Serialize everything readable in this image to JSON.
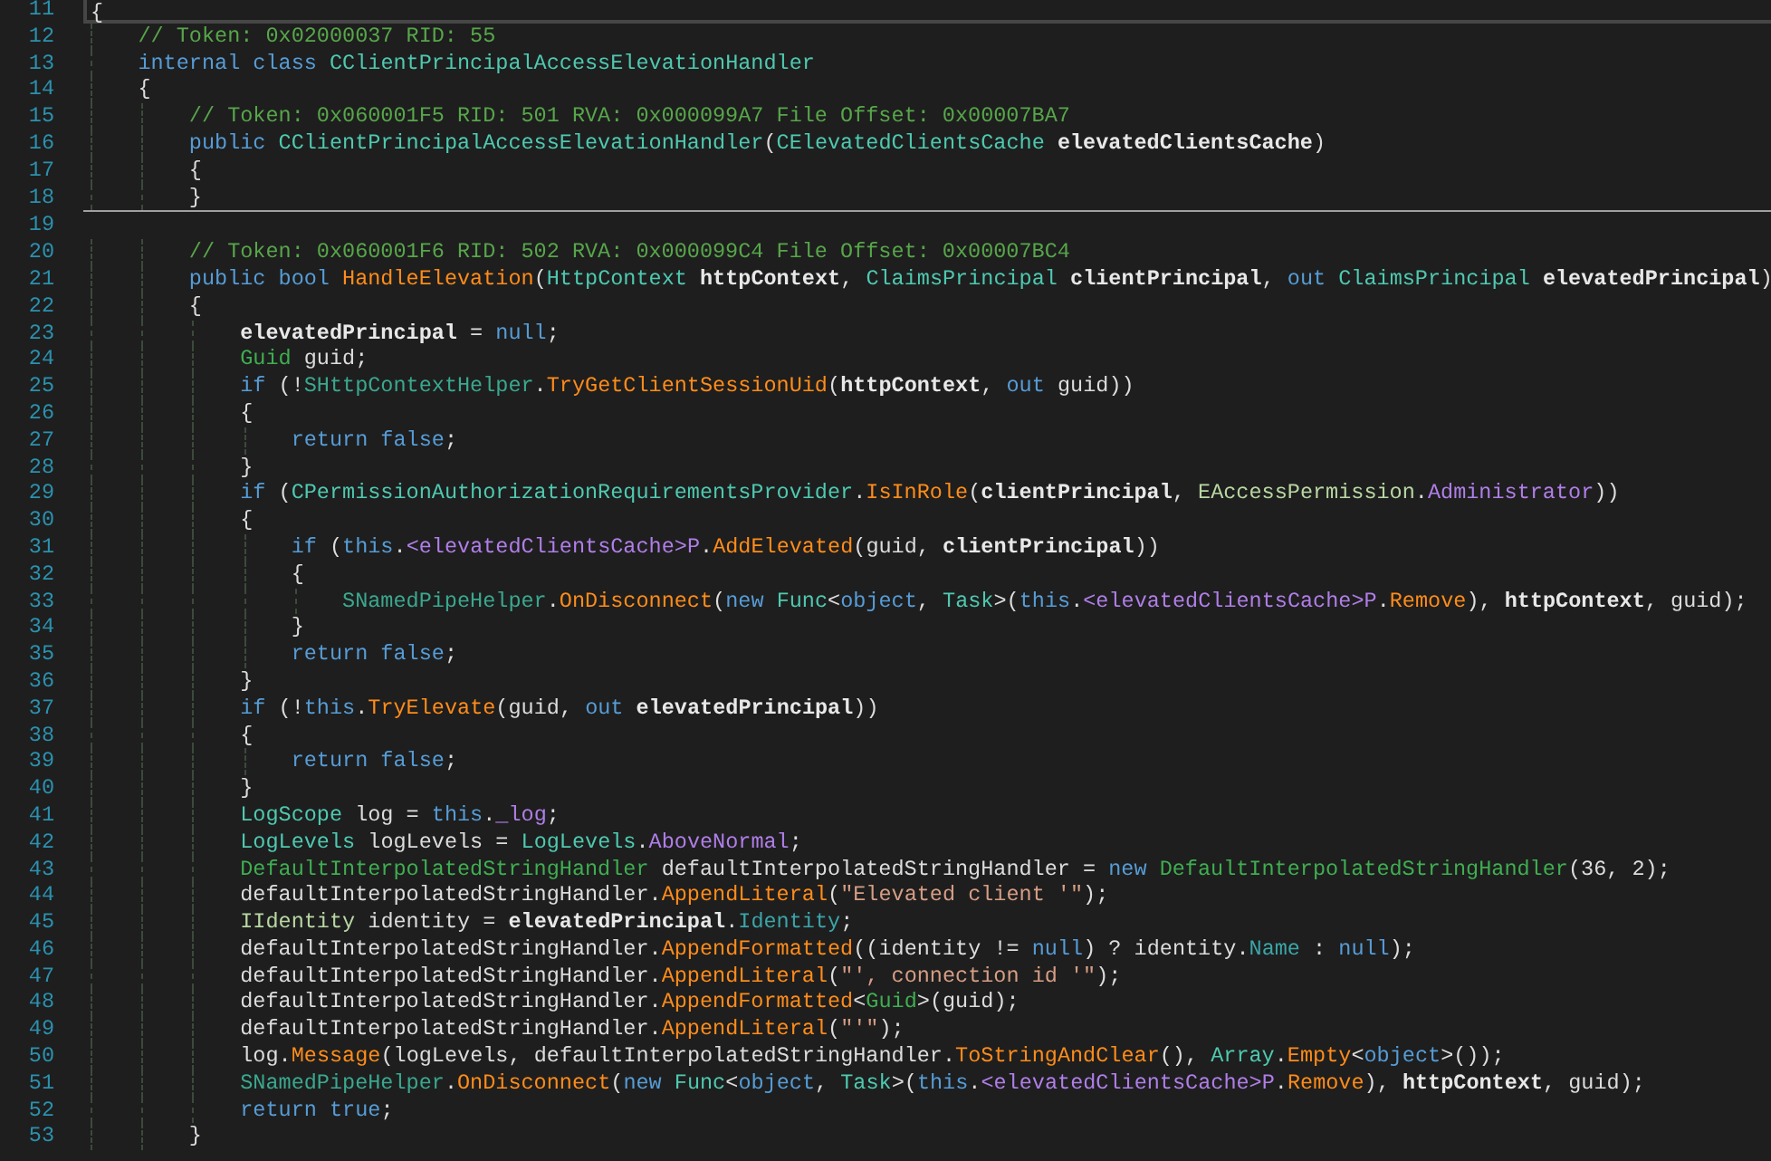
{
  "editor": {
    "blocks": [
      {
        "lines": [
          {
            "number": "11",
            "current": true,
            "tokens": [
              {
                "kind": "plain",
                "text": "{"
              }
            ]
          },
          {
            "number": "12",
            "current": false,
            "tokens": [
              {
                "kind": "comment",
                "text": "    // Token: 0x02000037 RID: 55"
              }
            ]
          },
          {
            "number": "13",
            "current": false,
            "tokens": [
              {
                "kind": "keyword",
                "text": "    internal class "
              },
              {
                "kind": "type",
                "text": "CClientPrincipalAccessElevationHandler"
              }
            ]
          },
          {
            "number": "14",
            "current": false,
            "tokens": [
              {
                "kind": "plain",
                "text": "    {"
              }
            ]
          },
          {
            "number": "15",
            "current": false,
            "tokens": [
              {
                "kind": "comment",
                "text": "        // Token: 0x060001F5 RID: 501 RVA: 0x000099A7 File Offset: 0x00007BA7"
              }
            ]
          },
          {
            "number": "16",
            "current": false,
            "tokens": [
              {
                "kind": "keyword",
                "text": "        public "
              },
              {
                "kind": "type",
                "text": "CClientPrincipalAccessElevationHandler"
              },
              {
                "kind": "plain",
                "text": "("
              },
              {
                "kind": "type",
                "text": "CElevatedClientsCache "
              },
              {
                "kind": "param",
                "text": "elevatedClientsCache"
              },
              {
                "kind": "plain",
                "text": ")"
              }
            ]
          },
          {
            "number": "17",
            "current": false,
            "tokens": [
              {
                "kind": "plain",
                "text": "        {"
              }
            ]
          },
          {
            "number": "18",
            "current": false,
            "tokens": [
              {
                "kind": "plain",
                "text": "        }"
              }
            ]
          }
        ]
      },
      {
        "lines": [
          {
            "number": "19",
            "current": false
          },
          {
            "number": "20",
            "current": false,
            "tokens": [
              {
                "kind": "comment",
                "text": "        // Token: 0x060001F6 RID: 502 RVA: 0x000099C4 File Offset: 0x00007BC4"
              }
            ]
          },
          {
            "number": "21",
            "current": false,
            "tokens": [
              {
                "kind": "keyword",
                "text": "        public bool "
              },
              {
                "kind": "method",
                "text": "HandleElevation"
              },
              {
                "kind": "plain",
                "text": "("
              },
              {
                "kind": "type",
                "text": "HttpContext "
              },
              {
                "kind": "param",
                "text": "httpContext"
              },
              {
                "kind": "plain",
                "text": ", "
              },
              {
                "kind": "type",
                "text": "ClaimsPrincipal "
              },
              {
                "kind": "param",
                "text": "clientPrincipal"
              },
              {
                "kind": "plain",
                "text": ", "
              },
              {
                "kind": "keyword",
                "text": "out "
              },
              {
                "kind": "type",
                "text": "ClaimsPrincipal "
              },
              {
                "kind": "param",
                "text": "elevatedPrincipal"
              },
              {
                "kind": "plain",
                "text": ")"
              }
            ]
          },
          {
            "number": "22",
            "current": false,
            "tokens": [
              {
                "kind": "plain",
                "text": "        {"
              }
            ]
          },
          {
            "number": "23",
            "current": false,
            "tokens": [
              {
                "kind": "param",
                "text": "            elevatedPrincipal"
              },
              {
                "kind": "plain",
                "text": " = "
              },
              {
                "kind": "keyword",
                "text": "null"
              },
              {
                "kind": "plain",
                "text": ";"
              }
            ]
          },
          {
            "number": "24",
            "current": false,
            "tokens": [
              {
                "kind": "struct",
                "text": "            Guid "
              },
              {
                "kind": "local",
                "text": "guid"
              },
              {
                "kind": "plain",
                "text": ";"
              }
            ]
          },
          {
            "number": "25",
            "current": false,
            "tokens": [
              {
                "kind": "keyword",
                "text": "            if"
              },
              {
                "kind": "plain",
                "text": " (!"
              },
              {
                "kind": "static",
                "text": "SHttpContextHelper"
              },
              {
                "kind": "plain",
                "text": "."
              },
              {
                "kind": "method",
                "text": "TryGetClientSessionUid"
              },
              {
                "kind": "plain",
                "text": "("
              },
              {
                "kind": "param",
                "text": "httpContext"
              },
              {
                "kind": "plain",
                "text": ", "
              },
              {
                "kind": "keyword",
                "text": "out "
              },
              {
                "kind": "local",
                "text": "guid"
              },
              {
                "kind": "plain",
                "text": "))"
              }
            ]
          },
          {
            "number": "26",
            "current": false,
            "tokens": [
              {
                "kind": "plain",
                "text": "            {"
              }
            ]
          },
          {
            "number": "27",
            "current": false,
            "tokens": [
              {
                "kind": "keyword",
                "text": "                return false"
              },
              {
                "kind": "plain",
                "text": ";"
              }
            ]
          },
          {
            "number": "28",
            "current": false,
            "tokens": [
              {
                "kind": "plain",
                "text": "            }"
              }
            ]
          },
          {
            "number": "29",
            "current": false,
            "tokens": [
              {
                "kind": "keyword",
                "text": "            if"
              },
              {
                "kind": "plain",
                "text": " ("
              },
              {
                "kind": "type",
                "text": "CPermissionAuthorizationRequirementsProvider"
              },
              {
                "kind": "plain",
                "text": "."
              },
              {
                "kind": "method",
                "text": "IsInRole"
              },
              {
                "kind": "plain",
                "text": "("
              },
              {
                "kind": "param",
                "text": "clientPrincipal"
              },
              {
                "kind": "plain",
                "text": ", "
              },
              {
                "kind": "enum",
                "text": "EAccessPermission"
              },
              {
                "kind": "plain",
                "text": "."
              },
              {
                "kind": "member",
                "text": "Administrator"
              },
              {
                "kind": "plain",
                "text": "))"
              }
            ]
          },
          {
            "number": "30",
            "current": false,
            "tokens": [
              {
                "kind": "plain",
                "text": "            {"
              }
            ]
          },
          {
            "number": "31",
            "current": false,
            "tokens": [
              {
                "kind": "keyword",
                "text": "                if"
              },
              {
                "kind": "plain",
                "text": " ("
              },
              {
                "kind": "keyword",
                "text": "this"
              },
              {
                "kind": "plain",
                "text": "."
              },
              {
                "kind": "member",
                "text": "<elevatedClientsCache>P"
              },
              {
                "kind": "plain",
                "text": "."
              },
              {
                "kind": "method",
                "text": "AddElevated"
              },
              {
                "kind": "plain",
                "text": "("
              },
              {
                "kind": "local",
                "text": "guid"
              },
              {
                "kind": "plain",
                "text": ", "
              },
              {
                "kind": "param",
                "text": "clientPrincipal"
              },
              {
                "kind": "plain",
                "text": "))"
              }
            ]
          },
          {
            "number": "32",
            "current": false,
            "tokens": [
              {
                "kind": "plain",
                "text": "                {"
              }
            ]
          },
          {
            "number": "33",
            "current": false,
            "tokens": [
              {
                "kind": "static",
                "text": "                    SNamedPipeHelper"
              },
              {
                "kind": "plain",
                "text": "."
              },
              {
                "kind": "method",
                "text": "OnDisconnect"
              },
              {
                "kind": "plain",
                "text": "("
              },
              {
                "kind": "keyword",
                "text": "new "
              },
              {
                "kind": "type",
                "text": "Func"
              },
              {
                "kind": "plain",
                "text": "<"
              },
              {
                "kind": "keyword",
                "text": "object"
              },
              {
                "kind": "plain",
                "text": ", "
              },
              {
                "kind": "type",
                "text": "Task"
              },
              {
                "kind": "plain",
                "text": ">("
              },
              {
                "kind": "keyword",
                "text": "this"
              },
              {
                "kind": "plain",
                "text": "."
              },
              {
                "kind": "member",
                "text": "<elevatedClientsCache>P"
              },
              {
                "kind": "plain",
                "text": "."
              },
              {
                "kind": "method",
                "text": "Remove"
              },
              {
                "kind": "plain",
                "text": "), "
              },
              {
                "kind": "param",
                "text": "httpContext"
              },
              {
                "kind": "plain",
                "text": ", "
              },
              {
                "kind": "local",
                "text": "guid"
              },
              {
                "kind": "plain",
                "text": ");"
              }
            ]
          },
          {
            "number": "34",
            "current": false,
            "tokens": [
              {
                "kind": "plain",
                "text": "                }"
              }
            ]
          },
          {
            "number": "35",
            "current": false,
            "tokens": [
              {
                "kind": "keyword",
                "text": "                return false"
              },
              {
                "kind": "plain",
                "text": ";"
              }
            ]
          },
          {
            "number": "36",
            "current": false,
            "tokens": [
              {
                "kind": "plain",
                "text": "            }"
              }
            ]
          },
          {
            "number": "37",
            "current": false,
            "tokens": [
              {
                "kind": "keyword",
                "text": "            if"
              },
              {
                "kind": "plain",
                "text": " (!"
              },
              {
                "kind": "keyword",
                "text": "this"
              },
              {
                "kind": "plain",
                "text": "."
              },
              {
                "kind": "method",
                "text": "TryElevate"
              },
              {
                "kind": "plain",
                "text": "("
              },
              {
                "kind": "local",
                "text": "guid"
              },
              {
                "kind": "plain",
                "text": ", "
              },
              {
                "kind": "keyword",
                "text": "out "
              },
              {
                "kind": "param",
                "text": "elevatedPrincipal"
              },
              {
                "kind": "plain",
                "text": "))"
              }
            ]
          },
          {
            "number": "38",
            "current": false,
            "tokens": [
              {
                "kind": "plain",
                "text": "            {"
              }
            ]
          },
          {
            "number": "39",
            "current": false,
            "tokens": [
              {
                "kind": "keyword",
                "text": "                return false"
              },
              {
                "kind": "plain",
                "text": ";"
              }
            ]
          },
          {
            "number": "40",
            "current": false,
            "tokens": [
              {
                "kind": "plain",
                "text": "            }"
              }
            ]
          },
          {
            "number": "41",
            "current": false,
            "tokens": [
              {
                "kind": "type",
                "text": "            LogScope "
              },
              {
                "kind": "local",
                "text": "log"
              },
              {
                "kind": "plain",
                "text": " = "
              },
              {
                "kind": "keyword",
                "text": "this"
              },
              {
                "kind": "plain",
                "text": "."
              },
              {
                "kind": "member",
                "text": "_log"
              },
              {
                "kind": "plain",
                "text": ";"
              }
            ]
          },
          {
            "number": "42",
            "current": false,
            "tokens": [
              {
                "kind": "type",
                "text": "            LogLevels "
              },
              {
                "kind": "local",
                "text": "logLevels"
              },
              {
                "kind": "plain",
                "text": " = "
              },
              {
                "kind": "type",
                "text": "LogLevels"
              },
              {
                "kind": "plain",
                "text": "."
              },
              {
                "kind": "member",
                "text": "AboveNormal"
              },
              {
                "kind": "plain",
                "text": ";"
              }
            ]
          },
          {
            "number": "43",
            "current": false,
            "tokens": [
              {
                "kind": "struct",
                "text": "            DefaultInterpolatedStringHandler "
              },
              {
                "kind": "local",
                "text": "defaultInterpolatedStringHandler"
              },
              {
                "kind": "plain",
                "text": " = "
              },
              {
                "kind": "keyword",
                "text": "new "
              },
              {
                "kind": "struct",
                "text": "DefaultInterpolatedStringHandler"
              },
              {
                "kind": "plain",
                "text": "(36, 2);"
              }
            ]
          },
          {
            "number": "44",
            "current": false,
            "tokens": [
              {
                "kind": "local",
                "text": "            defaultInterpolatedStringHandler"
              },
              {
                "kind": "plain",
                "text": "."
              },
              {
                "kind": "method",
                "text": "AppendLiteral"
              },
              {
                "kind": "plain",
                "text": "("
              },
              {
                "kind": "string",
                "text": "\"Elevated client '\""
              },
              {
                "kind": "plain",
                "text": ");"
              }
            ]
          },
          {
            "number": "45",
            "current": false,
            "tokens": [
              {
                "kind": "interface",
                "text": "            IIdentity "
              },
              {
                "kind": "local",
                "text": "identity"
              },
              {
                "kind": "plain",
                "text": " = "
              },
              {
                "kind": "param",
                "text": "elevatedPrincipal"
              },
              {
                "kind": "plain",
                "text": "."
              },
              {
                "kind": "property",
                "text": "Identity"
              },
              {
                "kind": "plain",
                "text": ";"
              }
            ]
          },
          {
            "number": "46",
            "current": false,
            "tokens": [
              {
                "kind": "local",
                "text": "            defaultInterpolatedStringHandler"
              },
              {
                "kind": "plain",
                "text": "."
              },
              {
                "kind": "method",
                "text": "AppendFormatted"
              },
              {
                "kind": "plain",
                "text": "(("
              },
              {
                "kind": "local",
                "text": "identity"
              },
              {
                "kind": "plain",
                "text": " != "
              },
              {
                "kind": "keyword",
                "text": "null"
              },
              {
                "kind": "plain",
                "text": ") ? "
              },
              {
                "kind": "local",
                "text": "identity"
              },
              {
                "kind": "plain",
                "text": "."
              },
              {
                "kind": "property",
                "text": "Name"
              },
              {
                "kind": "plain",
                "text": " : "
              },
              {
                "kind": "keyword",
                "text": "null"
              },
              {
                "kind": "plain",
                "text": ");"
              }
            ]
          },
          {
            "number": "47",
            "current": false,
            "tokens": [
              {
                "kind": "local",
                "text": "            defaultInterpolatedStringHandler"
              },
              {
                "kind": "plain",
                "text": "."
              },
              {
                "kind": "method",
                "text": "AppendLiteral"
              },
              {
                "kind": "plain",
                "text": "("
              },
              {
                "kind": "string",
                "text": "\"', connection id '\""
              },
              {
                "kind": "plain",
                "text": ");"
              }
            ]
          },
          {
            "number": "48",
            "current": false,
            "tokens": [
              {
                "kind": "local",
                "text": "            defaultInterpolatedStringHandler"
              },
              {
                "kind": "plain",
                "text": "."
              },
              {
                "kind": "method",
                "text": "AppendFormatted"
              },
              {
                "kind": "plain",
                "text": "<"
              },
              {
                "kind": "struct",
                "text": "Guid"
              },
              {
                "kind": "plain",
                "text": ">("
              },
              {
                "kind": "local",
                "text": "guid"
              },
              {
                "kind": "plain",
                "text": ");"
              }
            ]
          },
          {
            "number": "49",
            "current": false,
            "tokens": [
              {
                "kind": "local",
                "text": "            defaultInterpolatedStringHandler"
              },
              {
                "kind": "plain",
                "text": "."
              },
              {
                "kind": "method",
                "text": "AppendLiteral"
              },
              {
                "kind": "plain",
                "text": "("
              },
              {
                "kind": "string",
                "text": "\"'\""
              },
              {
                "kind": "plain",
                "text": ");"
              }
            ]
          },
          {
            "number": "50",
            "current": false,
            "tokens": [
              {
                "kind": "local",
                "text": "            log"
              },
              {
                "kind": "plain",
                "text": "."
              },
              {
                "kind": "method",
                "text": "Message"
              },
              {
                "kind": "plain",
                "text": "("
              },
              {
                "kind": "local",
                "text": "logLevels"
              },
              {
                "kind": "plain",
                "text": ", "
              },
              {
                "kind": "local",
                "text": "defaultInterpolatedStringHandler"
              },
              {
                "kind": "plain",
                "text": "."
              },
              {
                "kind": "method",
                "text": "ToStringAndClear"
              },
              {
                "kind": "plain",
                "text": "(), "
              },
              {
                "kind": "type",
                "text": "Array"
              },
              {
                "kind": "plain",
                "text": "."
              },
              {
                "kind": "method",
                "text": "Empty"
              },
              {
                "kind": "plain",
                "text": "<"
              },
              {
                "kind": "keyword",
                "text": "object"
              },
              {
                "kind": "plain",
                "text": ">());"
              }
            ]
          },
          {
            "number": "51",
            "current": false,
            "tokens": [
              {
                "kind": "static",
                "text": "            SNamedPipeHelper"
              },
              {
                "kind": "plain",
                "text": "."
              },
              {
                "kind": "method",
                "text": "OnDisconnect"
              },
              {
                "kind": "plain",
                "text": "("
              },
              {
                "kind": "keyword",
                "text": "new "
              },
              {
                "kind": "type",
                "text": "Func"
              },
              {
                "kind": "plain",
                "text": "<"
              },
              {
                "kind": "keyword",
                "text": "object"
              },
              {
                "kind": "plain",
                "text": ", "
              },
              {
                "kind": "type",
                "text": "Task"
              },
              {
                "kind": "plain",
                "text": ">("
              },
              {
                "kind": "keyword",
                "text": "this"
              },
              {
                "kind": "plain",
                "text": "."
              },
              {
                "kind": "member",
                "text": "<elevatedClientsCache>P"
              },
              {
                "kind": "plain",
                "text": "."
              },
              {
                "kind": "method",
                "text": "Remove"
              },
              {
                "kind": "plain",
                "text": "), "
              },
              {
                "kind": "param",
                "text": "httpContext"
              },
              {
                "kind": "plain",
                "text": ", "
              },
              {
                "kind": "local",
                "text": "guid"
              },
              {
                "kind": "plain",
                "text": ");"
              }
            ]
          },
          {
            "number": "52",
            "current": false,
            "tokens": [
              {
                "kind": "keyword",
                "text": "            return true"
              },
              {
                "kind": "plain",
                "text": ";"
              }
            ]
          },
          {
            "number": "53",
            "current": false,
            "tokens": [
              {
                "kind": "plain",
                "text": "        }"
              }
            ]
          }
        ]
      }
    ]
  }
}
